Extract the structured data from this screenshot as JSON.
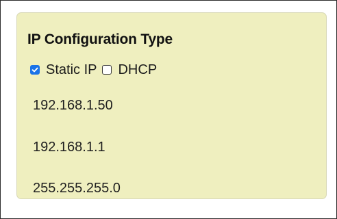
{
  "config": {
    "title": "IP Configuration Type",
    "options": [
      {
        "label": "Static IP",
        "checked": true
      },
      {
        "label": "DHCP",
        "checked": false
      }
    ],
    "ip_address": "192.168.1.50",
    "gateway": "192.168.1.1",
    "subnet_mask": "255.255.255.0"
  },
  "colors": {
    "panel_background": "#efefbf",
    "checkbox_checked": "#1a73e8"
  }
}
